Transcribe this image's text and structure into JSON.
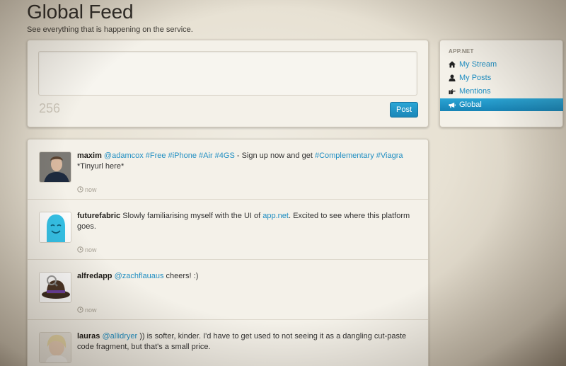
{
  "header": {
    "title": "Global Feed",
    "subtitle": "See everything that is happening on the service."
  },
  "composer": {
    "text_value": "",
    "char_count": "256",
    "post_label": "Post"
  },
  "sidebar": {
    "heading": "APP.NET",
    "items": [
      {
        "label": "My Stream",
        "icon": "home-icon",
        "active": false
      },
      {
        "label": "My Posts",
        "icon": "user-icon",
        "active": false
      },
      {
        "label": "Mentions",
        "icon": "pointing-hand-icon",
        "active": false
      },
      {
        "label": "Global",
        "icon": "megaphone-icon",
        "active": true
      }
    ]
  },
  "colors": {
    "accent": "#1f8ec2",
    "active_nav": "#1a8ec0",
    "panel": "#f4f1e9"
  },
  "feed": {
    "posts": [
      {
        "username": "maxim",
        "avatar": "photo-avatar-man",
        "segments": [
          {
            "text": "@adamcox",
            "link": true
          },
          {
            "text": " ",
            "link": false
          },
          {
            "text": "#Free",
            "link": true
          },
          {
            "text": " ",
            "link": false
          },
          {
            "text": "#iPhone",
            "link": true
          },
          {
            "text": " ",
            "link": false
          },
          {
            "text": "#Air",
            "link": true
          },
          {
            "text": " ",
            "link": false
          },
          {
            "text": "#4GS",
            "link": true
          },
          {
            "text": " - Sign up now and get ",
            "link": false
          },
          {
            "text": "#Complementary",
            "link": true
          },
          {
            "text": " ",
            "link": false
          },
          {
            "text": "#Viagra",
            "link": true
          },
          {
            "text": " *Tinyurl here*",
            "link": false
          }
        ],
        "time": "now"
      },
      {
        "username": "futurefabric",
        "avatar": "blue-blob-avatar",
        "segments": [
          {
            "text": "Slowly familiarising myself with the UI of ",
            "link": false
          },
          {
            "text": "app.net",
            "link": true
          },
          {
            "text": ". Excited to see where this platform goes.",
            "link": false
          }
        ],
        "time": "now"
      },
      {
        "username": "alfredapp",
        "avatar": "bowler-hat-avatar",
        "segments": [
          {
            "text": "@zachflauaus",
            "link": true
          },
          {
            "text": " cheers! :)",
            "link": false
          }
        ],
        "time": "now"
      },
      {
        "username": "lauras",
        "avatar": "photo-avatar-woman",
        "segments": [
          {
            "text": "@allidryer",
            "link": true
          },
          {
            "text": " )) is softer, kinder. I'd have to get used to not seeing it as a dangling cut-paste code fragment, but that's a small price.",
            "link": false
          }
        ],
        "time": ""
      }
    ]
  }
}
